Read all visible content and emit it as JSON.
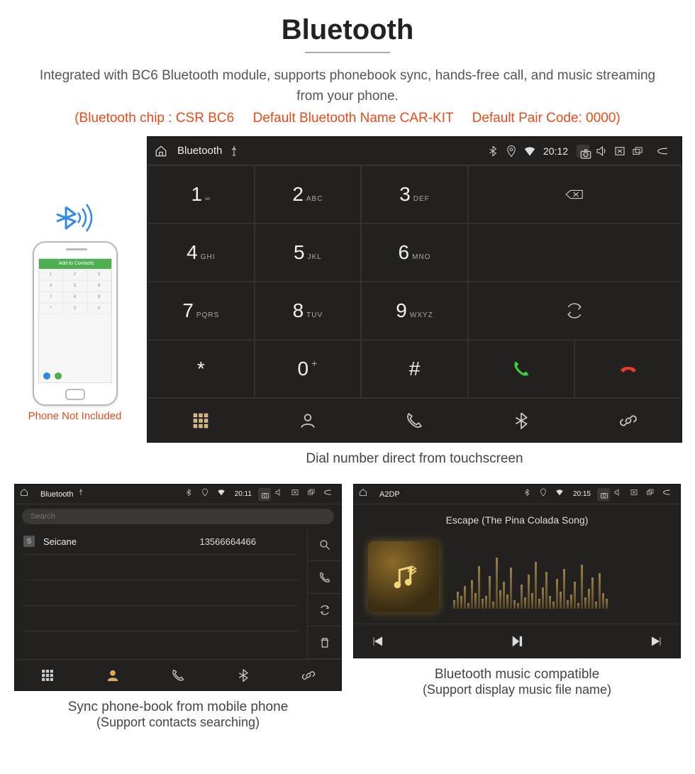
{
  "header": {
    "title": "Bluetooth",
    "desc": "Integrated with BC6 Bluetooth module, supports phonebook sync, hands-free call, and music streaming from your phone.",
    "spec": "(Bluetooth chip : CSR BC6     Default Bluetooth Name CAR-KIT     Default Pair Code: 0000)"
  },
  "phone": {
    "caption": "Phone Not Included",
    "topbar": "Add to Contacts",
    "keys": [
      "1",
      "2",
      "3",
      "4",
      "5",
      "6",
      "7",
      "8",
      "9",
      "*",
      "0",
      "#"
    ]
  },
  "dialer": {
    "status": {
      "title": "Bluetooth",
      "time": "20:12"
    },
    "keys": [
      {
        "num": "1",
        "let": "∞"
      },
      {
        "num": "2",
        "let": "ABC"
      },
      {
        "num": "3",
        "let": "DEF"
      },
      {
        "num": "4",
        "let": "GHI"
      },
      {
        "num": "5",
        "let": "JKL"
      },
      {
        "num": "6",
        "let": "MNO"
      },
      {
        "num": "7",
        "let": "PQRS"
      },
      {
        "num": "8",
        "let": "TUV"
      },
      {
        "num": "9",
        "let": "WXYZ"
      },
      {
        "num": "*",
        "let": ""
      },
      {
        "num": "0",
        "let": "+"
      },
      {
        "num": "#",
        "let": ""
      }
    ],
    "caption": "Dial number direct from touchscreen"
  },
  "contacts": {
    "status": {
      "title": "Bluetooth",
      "time": "20:11"
    },
    "search_placeholder": "Search",
    "list": [
      {
        "badge": "S",
        "name": "Seicane",
        "phone": "13566664466"
      }
    ],
    "caption_line1": "Sync phone-book from mobile phone",
    "caption_line2": "(Support contacts searching)"
  },
  "music": {
    "status": {
      "title": "A2DP",
      "time": "20:15"
    },
    "song": "Escape (The Pina Colada Song)",
    "caption_line1": "Bluetooth music compatible",
    "caption_line2": "(Support display music file name)",
    "eq_heights": [
      12,
      24,
      18,
      32,
      8,
      40,
      22,
      60,
      14,
      18,
      46,
      10,
      72,
      26,
      38,
      20,
      58,
      12,
      8,
      34,
      16,
      48,
      22,
      66,
      14,
      30,
      52,
      18,
      10,
      42,
      24,
      56,
      12,
      20,
      38,
      8,
      62,
      16,
      28,
      44,
      10,
      50,
      22,
      14
    ]
  }
}
